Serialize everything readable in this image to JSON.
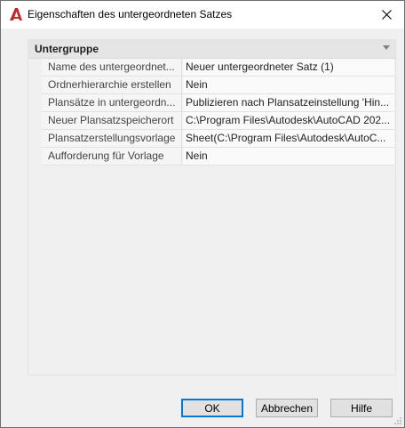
{
  "window": {
    "title": "Eigenschaften des untergeordneten Satzes",
    "app_icon": "autocad-a-icon",
    "accent_color": "#c1272d"
  },
  "group": {
    "title": "Untergruppe",
    "rows": [
      {
        "name": "Name des untergeordnet...",
        "value": "Neuer untergeordneter Satz (1)"
      },
      {
        "name": "Ordnerhierarchie erstellen",
        "value": "Nein"
      },
      {
        "name": "Plansätze in untergeordn...",
        "value": "Publizieren nach Plansatzeinstellung 'Hin..."
      },
      {
        "name": "Neuer Plansatzspeicherort",
        "value": "C:\\Program Files\\Autodesk\\AutoCAD 202..."
      },
      {
        "name": "Plansatzerstellungsvorlage",
        "value": "Sheet(C:\\Program Files\\Autodesk\\AutoC..."
      },
      {
        "name": "Aufforderung für Vorlage",
        "value": "Nein"
      }
    ]
  },
  "buttons": {
    "ok": "OK",
    "cancel": "Abbrechen",
    "help": "Hilfe"
  }
}
